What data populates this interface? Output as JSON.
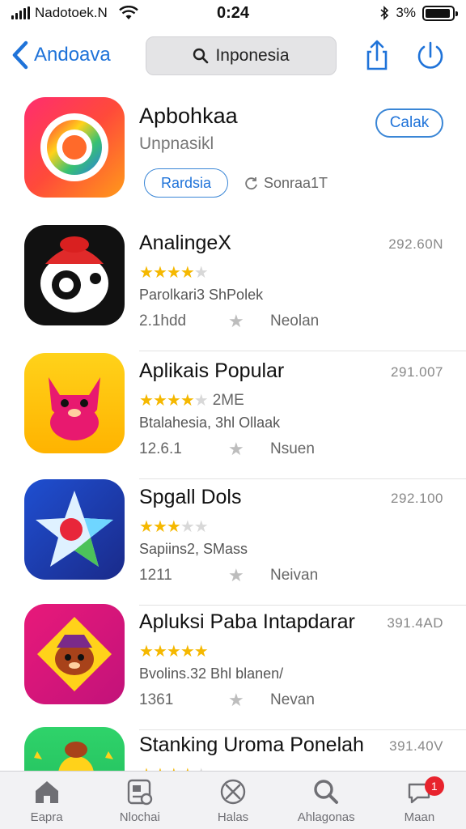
{
  "status_bar": {
    "carrier": "Nadotoek.N",
    "time": "0:24",
    "battery_percent": "3%"
  },
  "nav": {
    "back_label": "Andoava",
    "search_text": "Inponesia",
    "icons": [
      "chevron-left-icon",
      "search-icon",
      "share-icon",
      "power-icon"
    ]
  },
  "featured": {
    "title": "Apbohkaa",
    "subtitle": "Unpnasikl",
    "get_label": "Calak",
    "pill_label": "Rardsia",
    "size_label": "Sonraa1T"
  },
  "apps": [
    {
      "name": "AnalingeX",
      "price": "292.60N",
      "stars": 3.5,
      "rating_extra": "",
      "desc": "Parolkari3 ShPolek",
      "meta_left": "2.1hdd",
      "meta_right": "Neolan"
    },
    {
      "name": "Aplikais Popular",
      "price": "291.007",
      "stars": 4,
      "rating_extra": "2ME",
      "desc": "Btalahesia, 3hl Ollaak",
      "meta_left": "12.6.1",
      "meta_right": "Nsuen"
    },
    {
      "name": "Spgall Dols",
      "price": "292.100",
      "stars": 3,
      "rating_extra": "",
      "desc": "Sapiins2, SMass",
      "meta_left": "1211",
      "meta_right": "Neivan"
    },
    {
      "name": "Apluksi Paba Intapdarar",
      "price": "391.4AD",
      "stars": 4.5,
      "rating_extra": "",
      "desc": "Bvolins.32 Bhl blanen/",
      "meta_left": "1361",
      "meta_right": "Nevan"
    },
    {
      "name": "Stanking Uroma Ponelah",
      "price": "391.40V",
      "stars": 4,
      "rating_extra": "",
      "desc": "",
      "meta_left": "",
      "meta_right": ""
    }
  ],
  "tabs": [
    {
      "label": "Eapra",
      "icon": "home-icon"
    },
    {
      "label": "Nlochai",
      "icon": "apps-icon"
    },
    {
      "label": "Halas",
      "icon": "compass-icon"
    },
    {
      "label": "Ahlagonas",
      "icon": "search-icon"
    },
    {
      "label": "Maan",
      "icon": "chat-icon",
      "badge": "1"
    }
  ],
  "colors": {
    "accent": "#1f73d9",
    "star": "#f5b800",
    "badge": "#e8232d"
  }
}
